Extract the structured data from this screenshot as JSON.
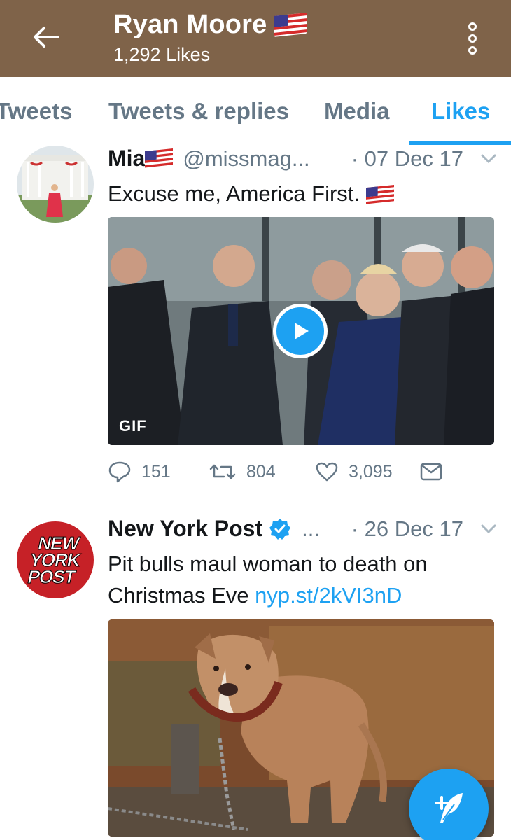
{
  "header": {
    "title": "Ryan Moore",
    "title_flag": "us-flag-emoji",
    "subtitle": "1,292 Likes",
    "back_icon": "arrow-left-icon",
    "menu_icon": "more-vertical-icon",
    "bg_color": "#7f6349"
  },
  "tabs": [
    {
      "label": "Tweets",
      "active": false
    },
    {
      "label": "Tweets & replies",
      "active": false
    },
    {
      "label": "Media",
      "active": false
    },
    {
      "label": "Likes",
      "active": true
    }
  ],
  "tweets": [
    {
      "name": "Mia",
      "name_flag": "us-flag-emoji",
      "handle": "@missmag...",
      "date": "· 07 Dec 17",
      "text": "Excuse me, America First.",
      "text_flag": "us-flag-emoji",
      "media_badge": "GIF",
      "replies": "151",
      "retweets": "804",
      "likes": "3,095"
    },
    {
      "name": "New York Post",
      "verified": true,
      "handle": "...",
      "date": "· 26 Dec 17",
      "text": "Pit bulls maul woman to death on Christmas Eve",
      "link": "nyp.st/2kVI3nD",
      "avatar_lines": [
        "NEW",
        "YORK",
        "POST"
      ]
    }
  ],
  "fab": {
    "icon": "compose-tweet-icon",
    "color": "#1da1f2"
  }
}
